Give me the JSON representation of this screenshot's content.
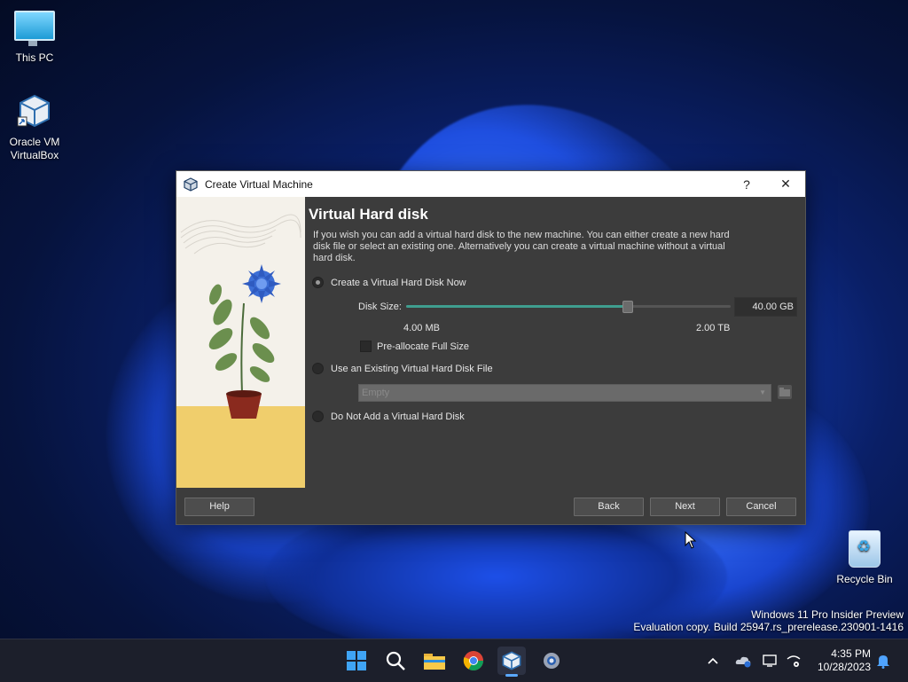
{
  "desktop": {
    "icons": [
      {
        "label": "This PC"
      },
      {
        "label_line1": "Oracle VM",
        "label_line2": "VirtualBox"
      },
      {
        "label": "Recycle Bin"
      }
    ],
    "watermark": {
      "line1": "Windows 11 Pro Insider Preview",
      "line2": "Evaluation copy. Build 25947.rs_prerelease.230901-1416"
    }
  },
  "dialog": {
    "title": "Create Virtual Machine",
    "help_glyph": "?",
    "close_glyph": "✕",
    "heading": "Virtual Hard disk",
    "description": "If you wish you can add a virtual hard disk to the new machine. You can either create a new hard disk file or select an existing one. Alternatively you can create a virtual machine without a virtual hard disk.",
    "options": {
      "create_now": {
        "label": "Create a Virtual Hard Disk Now",
        "selected": true
      },
      "use_existing": {
        "label": "Use an Existing Virtual Hard Disk File",
        "selected": false
      },
      "do_not_add": {
        "label": "Do Not Add a Virtual Hard Disk",
        "selected": false
      }
    },
    "disk_size": {
      "label": "Disk Size:",
      "value": "40.00 GB",
      "min_label": "4.00 MB",
      "max_label": "2.00 TB",
      "slider_fraction": 0.68
    },
    "preallocate": {
      "label": "Pre-allocate Full Size",
      "checked": false
    },
    "existing_file_combo": {
      "value": "Empty"
    },
    "buttons": {
      "help": "Help",
      "back": "Back",
      "next": "Next",
      "cancel": "Cancel"
    }
  },
  "taskbar": {
    "apps": [
      "start-icon",
      "search-icon",
      "file-explorer-icon",
      "chrome-icon",
      "virtualbox-icon",
      "settings-icon"
    ],
    "clock": {
      "time": "4:35 PM",
      "date": "10/28/2023"
    }
  },
  "colors": {
    "dialog_bg": "#3c3c3c",
    "accent_slider": "#3f9e8f",
    "taskbar_bg": "#1c1f2b"
  }
}
